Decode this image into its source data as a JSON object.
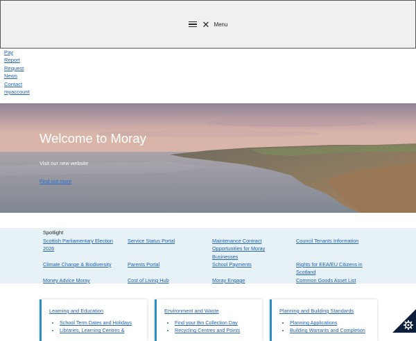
{
  "menu": {
    "label": "Menu"
  },
  "quick_links": [
    {
      "label": "Pay"
    },
    {
      "label": "Report"
    },
    {
      "label": "Request"
    },
    {
      "label": "News"
    },
    {
      "label": "Contact"
    },
    {
      "label": "myaccount"
    }
  ],
  "hero": {
    "title": "Welcome to Moray",
    "subtitle": "Visit our new website",
    "link": "Find out more"
  },
  "spotlight": {
    "title": "Spotlight",
    "links": [
      {
        "label": "Scottish Parliamentary Election 2026"
      },
      {
        "label": "Service Status Portal"
      },
      {
        "label": "Maintenance Contract Opportunities for Moray Businesses"
      },
      {
        "label": "Council Tenants Information"
      },
      {
        "label": "Climate Change & Biodiversity"
      },
      {
        "label": "Parents Portal"
      },
      {
        "label": "School Payments"
      },
      {
        "label": "Rights for EEA/EU Citizens in Scotland"
      },
      {
        "label": "Money Advice Moray"
      },
      {
        "label": "Cost of Living Hub"
      },
      {
        "label": "Moray Engage"
      },
      {
        "label": "Common Goods Asset List"
      }
    ]
  },
  "cards": [
    {
      "title": "Learning and Education",
      "items": [
        {
          "label": "School Term Dates and Holidays"
        },
        {
          "label": "Libraries, Learning Centres &"
        }
      ]
    },
    {
      "title": "Environment and Waste",
      "items": [
        {
          "label": "Find your Bin Collection Day"
        },
        {
          "label": "Recycling Centres and Points"
        }
      ]
    },
    {
      "title": "Planning and Building Standards",
      "items": [
        {
          "label": "Planning Applications"
        },
        {
          "label": "Building Warrants and Completion"
        }
      ]
    }
  ],
  "colors": {
    "link": "#1f5fb5",
    "spotlight_bg": "#e6f2f6",
    "card_accent": "#2a8fbd",
    "cookie_bg": "#0b1f3a"
  },
  "icons": {
    "menu": "hamburger-icon",
    "close": "close-icon",
    "cookie": "gear-icon"
  }
}
